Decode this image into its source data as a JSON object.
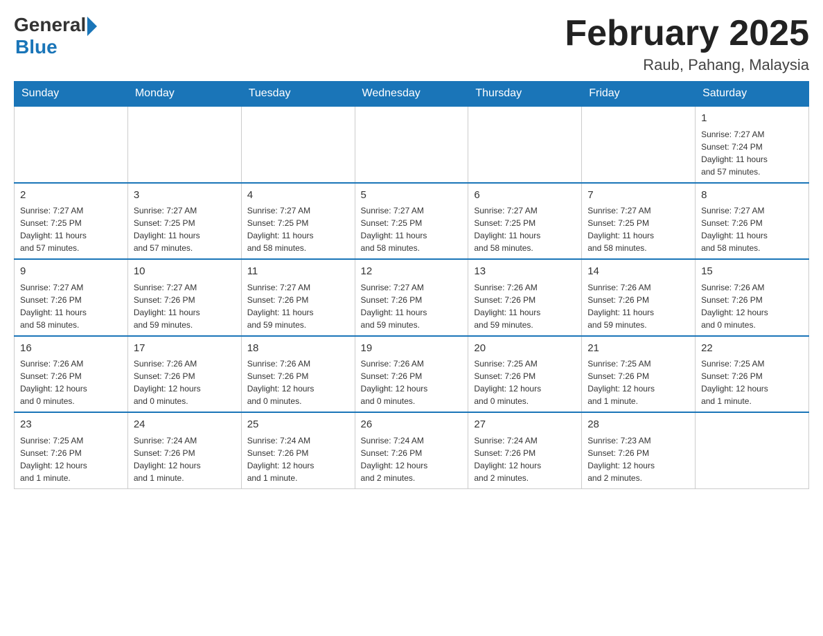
{
  "header": {
    "logo_general": "General",
    "logo_blue": "Blue",
    "month_title": "February 2025",
    "location": "Raub, Pahang, Malaysia"
  },
  "days_of_week": [
    "Sunday",
    "Monday",
    "Tuesday",
    "Wednesday",
    "Thursday",
    "Friday",
    "Saturday"
  ],
  "weeks": [
    [
      {
        "day": "",
        "info": "",
        "empty": true
      },
      {
        "day": "",
        "info": "",
        "empty": true
      },
      {
        "day": "",
        "info": "",
        "empty": true
      },
      {
        "day": "",
        "info": "",
        "empty": true
      },
      {
        "day": "",
        "info": "",
        "empty": true
      },
      {
        "day": "",
        "info": "",
        "empty": true
      },
      {
        "day": "1",
        "info": "Sunrise: 7:27 AM\nSunset: 7:24 PM\nDaylight: 11 hours\nand 57 minutes."
      }
    ],
    [
      {
        "day": "2",
        "info": "Sunrise: 7:27 AM\nSunset: 7:25 PM\nDaylight: 11 hours\nand 57 minutes."
      },
      {
        "day": "3",
        "info": "Sunrise: 7:27 AM\nSunset: 7:25 PM\nDaylight: 11 hours\nand 57 minutes."
      },
      {
        "day": "4",
        "info": "Sunrise: 7:27 AM\nSunset: 7:25 PM\nDaylight: 11 hours\nand 58 minutes."
      },
      {
        "day": "5",
        "info": "Sunrise: 7:27 AM\nSunset: 7:25 PM\nDaylight: 11 hours\nand 58 minutes."
      },
      {
        "day": "6",
        "info": "Sunrise: 7:27 AM\nSunset: 7:25 PM\nDaylight: 11 hours\nand 58 minutes."
      },
      {
        "day": "7",
        "info": "Sunrise: 7:27 AM\nSunset: 7:25 PM\nDaylight: 11 hours\nand 58 minutes."
      },
      {
        "day": "8",
        "info": "Sunrise: 7:27 AM\nSunset: 7:26 PM\nDaylight: 11 hours\nand 58 minutes."
      }
    ],
    [
      {
        "day": "9",
        "info": "Sunrise: 7:27 AM\nSunset: 7:26 PM\nDaylight: 11 hours\nand 58 minutes."
      },
      {
        "day": "10",
        "info": "Sunrise: 7:27 AM\nSunset: 7:26 PM\nDaylight: 11 hours\nand 59 minutes."
      },
      {
        "day": "11",
        "info": "Sunrise: 7:27 AM\nSunset: 7:26 PM\nDaylight: 11 hours\nand 59 minutes."
      },
      {
        "day": "12",
        "info": "Sunrise: 7:27 AM\nSunset: 7:26 PM\nDaylight: 11 hours\nand 59 minutes."
      },
      {
        "day": "13",
        "info": "Sunrise: 7:26 AM\nSunset: 7:26 PM\nDaylight: 11 hours\nand 59 minutes."
      },
      {
        "day": "14",
        "info": "Sunrise: 7:26 AM\nSunset: 7:26 PM\nDaylight: 11 hours\nand 59 minutes."
      },
      {
        "day": "15",
        "info": "Sunrise: 7:26 AM\nSunset: 7:26 PM\nDaylight: 12 hours\nand 0 minutes."
      }
    ],
    [
      {
        "day": "16",
        "info": "Sunrise: 7:26 AM\nSunset: 7:26 PM\nDaylight: 12 hours\nand 0 minutes."
      },
      {
        "day": "17",
        "info": "Sunrise: 7:26 AM\nSunset: 7:26 PM\nDaylight: 12 hours\nand 0 minutes."
      },
      {
        "day": "18",
        "info": "Sunrise: 7:26 AM\nSunset: 7:26 PM\nDaylight: 12 hours\nand 0 minutes."
      },
      {
        "day": "19",
        "info": "Sunrise: 7:26 AM\nSunset: 7:26 PM\nDaylight: 12 hours\nand 0 minutes."
      },
      {
        "day": "20",
        "info": "Sunrise: 7:25 AM\nSunset: 7:26 PM\nDaylight: 12 hours\nand 0 minutes."
      },
      {
        "day": "21",
        "info": "Sunrise: 7:25 AM\nSunset: 7:26 PM\nDaylight: 12 hours\nand 1 minute."
      },
      {
        "day": "22",
        "info": "Sunrise: 7:25 AM\nSunset: 7:26 PM\nDaylight: 12 hours\nand 1 minute."
      }
    ],
    [
      {
        "day": "23",
        "info": "Sunrise: 7:25 AM\nSunset: 7:26 PM\nDaylight: 12 hours\nand 1 minute."
      },
      {
        "day": "24",
        "info": "Sunrise: 7:24 AM\nSunset: 7:26 PM\nDaylight: 12 hours\nand 1 minute."
      },
      {
        "day": "25",
        "info": "Sunrise: 7:24 AM\nSunset: 7:26 PM\nDaylight: 12 hours\nand 1 minute."
      },
      {
        "day": "26",
        "info": "Sunrise: 7:24 AM\nSunset: 7:26 PM\nDaylight: 12 hours\nand 2 minutes."
      },
      {
        "day": "27",
        "info": "Sunrise: 7:24 AM\nSunset: 7:26 PM\nDaylight: 12 hours\nand 2 minutes."
      },
      {
        "day": "28",
        "info": "Sunrise: 7:23 AM\nSunset: 7:26 PM\nDaylight: 12 hours\nand 2 minutes."
      },
      {
        "day": "",
        "info": "",
        "empty": true
      }
    ]
  ]
}
